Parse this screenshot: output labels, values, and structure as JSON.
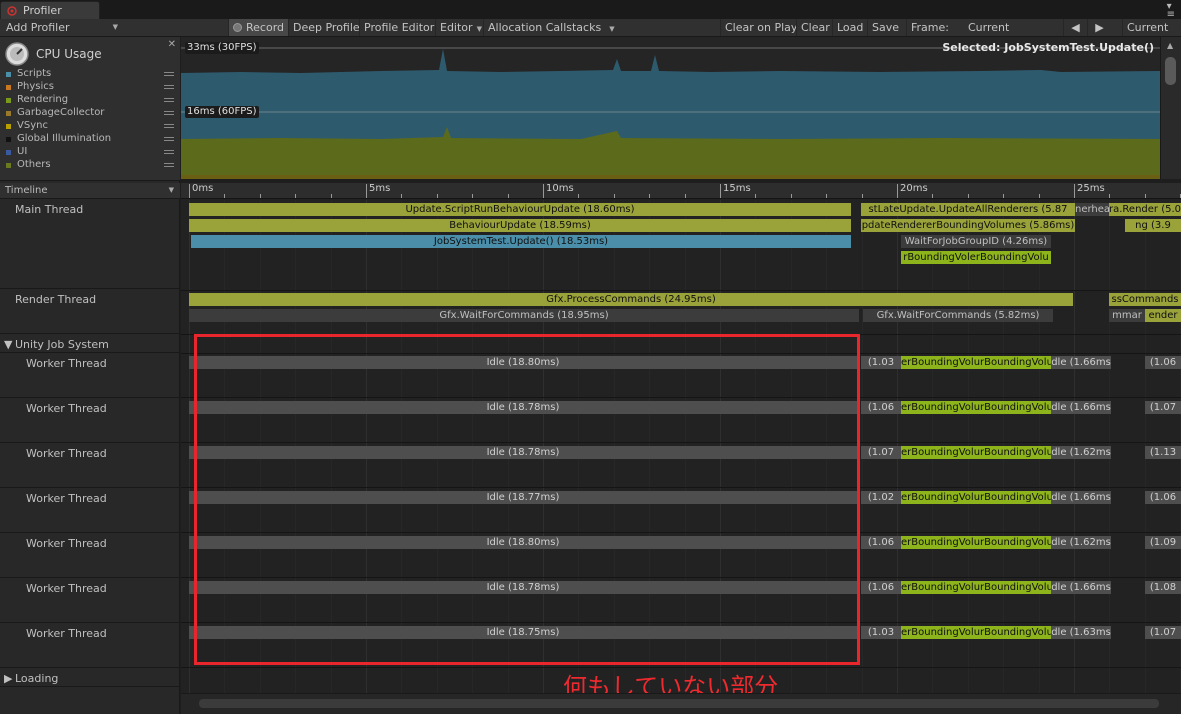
{
  "tab": {
    "title": "Profiler"
  },
  "toolbar": {
    "add_profiler": "Add Profiler",
    "record": "Record",
    "deep_profile": "Deep Profile",
    "profile_editor": "Profile Editor",
    "editor": "Editor",
    "allocation_callstacks": "Allocation Callstacks",
    "clear_on_play": "Clear on Play",
    "clear": "Clear",
    "load": "Load",
    "save": "Save",
    "frame_label": "Frame:",
    "frame_value": "Current",
    "current": "Current"
  },
  "cpu_module": {
    "title": "CPU Usage",
    "legend": [
      {
        "name": "Scripts",
        "color": "#4a8eaa"
      },
      {
        "name": "Physics",
        "color": "#c87820"
      },
      {
        "name": "Rendering",
        "color": "#7a9a1a"
      },
      {
        "name": "GarbageCollector",
        "color": "#9a7a2a"
      },
      {
        "name": "VSync",
        "color": "#b8a000"
      },
      {
        "name": "Global Illumination",
        "color": "#111111"
      },
      {
        "name": "UI",
        "color": "#3a5aa0"
      },
      {
        "name": "Others",
        "color": "#6a7a20"
      }
    ]
  },
  "chart": {
    "label_30fps": "33ms (30FPS)",
    "label_60fps": "16ms (60FPS)",
    "selected": "Selected: JobSystemTest.Update()"
  },
  "timeline": {
    "view_mode": "Timeline",
    "ticks": [
      "0ms",
      "5ms",
      "10ms",
      "15ms",
      "20ms",
      "25ms"
    ],
    "main_thread": {
      "label": "Main Thread",
      "bars": [
        "Update.ScriptRunBehaviourUpdate (18.60ms)",
        "BehaviourUpdate (18.59ms)",
        "JobSystemTest.Update() (18.53ms)",
        "stLateUpdate.UpdateAllRenderers (5.87",
        "pdateRendererBoundingVolumes (5.86ms)",
        "WaitForJobGroupID (4.26ms)",
        "rBoundingVolerBoundingVolu",
        "nerhead",
        "ra.Render (5.0",
        "ng (3.9"
      ]
    },
    "render_thread": {
      "label": "Render Thread",
      "bars": [
        "Gfx.ProcessCommands (24.95ms)",
        "Gfx.WaitForCommands (18.95ms)",
        "Gfx.WaitForCommands (5.82ms)",
        "ssCommands",
        "mmar",
        "ender"
      ]
    },
    "job_system": {
      "label": "Unity Job System"
    },
    "workers": [
      {
        "label": "Worker Thread",
        "idle": "Idle (18.80ms)",
        "idle_short": "(1.03",
        "mid": "erBoundingVolurBoundingVolu",
        "idle2": "dle (1.66ms",
        "tail": "(1.06"
      },
      {
        "label": "Worker Thread",
        "idle": "Idle (18.78ms)",
        "idle_short": "(1.06",
        "mid": "erBoundingVolurBoundingVolu",
        "idle2": "dle (1.66ms",
        "tail": "(1.07"
      },
      {
        "label": "Worker Thread",
        "idle": "Idle (18.78ms)",
        "idle_short": "(1.07",
        "mid": "erBoundingVolurBoundingVolu",
        "idle2": "dle (1.62ms",
        "tail": "(1.13"
      },
      {
        "label": "Worker Thread",
        "idle": "Idle (18.77ms)",
        "idle_short": "(1.02",
        "mid": "erBoundingVolurBoundingVolu",
        "idle2": "dle (1.66ms",
        "tail": "(1.06"
      },
      {
        "label": "Worker Thread",
        "idle": "Idle (18.80ms)",
        "idle_short": "(1.06",
        "mid": "erBoundingVolurBoundingVolu",
        "idle2": "dle (1.62ms",
        "tail": "(1.09"
      },
      {
        "label": "Worker Thread",
        "idle": "Idle (18.78ms)",
        "idle_short": "(1.06",
        "mid": "erBoundingVolurBoundingVolu",
        "idle2": "dle (1.66ms",
        "tail": "(1.08"
      },
      {
        "label": "Worker Thread",
        "idle": "Idle (18.75ms)",
        "idle_short": "(1.03",
        "mid": "erBoundingVolurBoundingVolu",
        "idle2": "dle (1.63ms",
        "tail": "(1.07"
      }
    ],
    "loading": {
      "label": "Loading"
    }
  },
  "annotation": "何もしていない部分"
}
